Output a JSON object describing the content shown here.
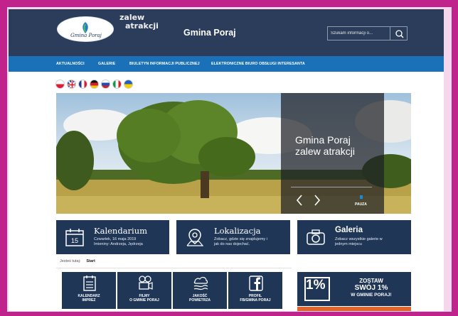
{
  "header": {
    "logo_oval_text": "Gmina Poraj",
    "logo_script_line1": "zalew",
    "logo_script_line2": "atrakcji",
    "site_title": "Gmina Poraj",
    "search_placeholder": "Szukam informacji o..."
  },
  "nav": {
    "items": [
      "AKTUALNOŚCI",
      "GALERIE",
      "BIULETYN INFORMACJI PUBLICZNEJ",
      "ELEKTRONICZNE BIURO OBSŁUGI INTERESANTA"
    ]
  },
  "flags": [
    "polish-flag-icon",
    "british-flag-icon",
    "french-flag-icon",
    "german-flag-icon",
    "russian-flag-icon",
    "italian-flag-icon",
    "ukrainian-flag-icon"
  ],
  "hero": {
    "caption_line1": "Gmina Poraj",
    "caption_line2": "zalew atrakcji",
    "pause_label": "PAUZA"
  },
  "tiles": [
    {
      "title": "Kalendarium",
      "line1": "Czwartek, 16 maja 2019",
      "line2": "Imieniny: Andrzeja, Jędrzeja",
      "icon": "calendar-icon",
      "day": "15"
    },
    {
      "title": "Lokalizacja",
      "line1": "Zobacz, gdzie się znajdujemy i",
      "line2": "jak do nas dojechać.",
      "icon": "map-pin-icon"
    },
    {
      "title": "Galeria",
      "line1": "Zobacz wszystkie galerie w",
      "line2": "jednym miejscu",
      "icon": "camera-icon"
    }
  ],
  "breadcrumb": {
    "prefix": "Jesteś tutaj:",
    "current": "Start"
  },
  "quick_tiles": [
    {
      "line1": "KALENDARZ",
      "line2": "IMPREZ",
      "icon": "calendar-list-icon"
    },
    {
      "line1": "FILMY",
      "line2": "O GMINIE PORAJ",
      "icon": "film-camera-icon"
    },
    {
      "line1": "JAKOŚĆ",
      "line2": "POWIETRZA",
      "icon": "air-quality-icon"
    },
    {
      "line1": "PROFIL",
      "line2": "FB/GMINA PORAJ",
      "icon": "facebook-icon"
    }
  ],
  "banner": {
    "percent": "1%",
    "line1": "ZOSTAW",
    "line2": "SWÓJ 1%",
    "line3": "W GMINIE PORAJ!"
  },
  "colors": {
    "header_bg": "#2b3d5b",
    "nav_bg": "#1a71b8",
    "tile_bg": "#1f3657",
    "outer_border": "#c0238b"
  }
}
